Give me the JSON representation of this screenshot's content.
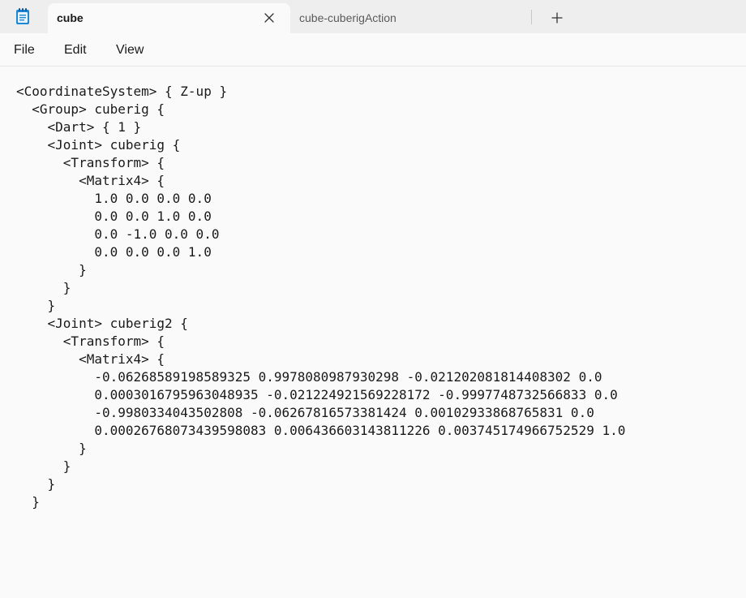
{
  "tabs": {
    "active": {
      "title": "cube"
    },
    "inactive": {
      "title": "cube-cuberigAction"
    }
  },
  "icons": {
    "app": "notepad-icon",
    "close": "close-icon",
    "new_tab": "plus-icon"
  },
  "menu": {
    "file": "File",
    "edit": "Edit",
    "view": "View"
  },
  "colors": {
    "tab_strip": "#eeeeee",
    "editor_background": "#fafafa",
    "text": "#1a1a1a",
    "app_icon_accent": "#1e88d6"
  },
  "editor": {
    "lines": [
      "<CoordinateSystem> { Z-up }",
      "  <Group> cuberig {",
      "    <Dart> { 1 }",
      "    <Joint> cuberig {",
      "      <Transform> {",
      "        <Matrix4> {",
      "          1.0 0.0 0.0 0.0",
      "          0.0 0.0 1.0 0.0",
      "          0.0 -1.0 0.0 0.0",
      "          0.0 0.0 0.0 1.0",
      "        }",
      "      }",
      "    }",
      "    <Joint> cuberig2 {",
      "      <Transform> {",
      "        <Matrix4> {",
      "          -0.06268589198589325 0.9978080987930298 -0.021202081814408302 0.0",
      "          0.0003016795963048935 -0.021224921569228172 -0.9997748732566833 0.0",
      "          -0.9980334043502808 -0.06267816573381424 0.00102933868765831 0.0",
      "          0.00026768073439598083 0.006436603143811226 0.003745174966752529 1.0",
      "        }",
      "      }",
      "    }",
      "  }"
    ]
  }
}
